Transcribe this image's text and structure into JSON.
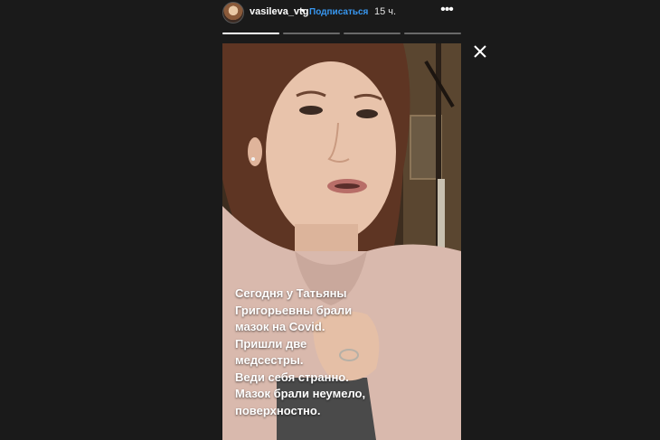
{
  "header": {
    "username": "vasileva_vtg",
    "separator": "•",
    "follow_label": "Подписаться",
    "time_ago": "15 ч.",
    "more_icon": "more-horizontal-icon",
    "progress_segments": 4,
    "progress_done": 1,
    "close_icon": "close-icon"
  },
  "story": {
    "caption": "Сегодня у Татьяны\nГригорьевны брали\nмазок на Covid.\nПришли две\nмедсестры.\nВеди себя странно.\nМазок брали неумело,\nповерхностно."
  },
  "colors": {
    "background": "#1a1a1a",
    "follow": "#3897f0",
    "text": "#ffffff"
  }
}
